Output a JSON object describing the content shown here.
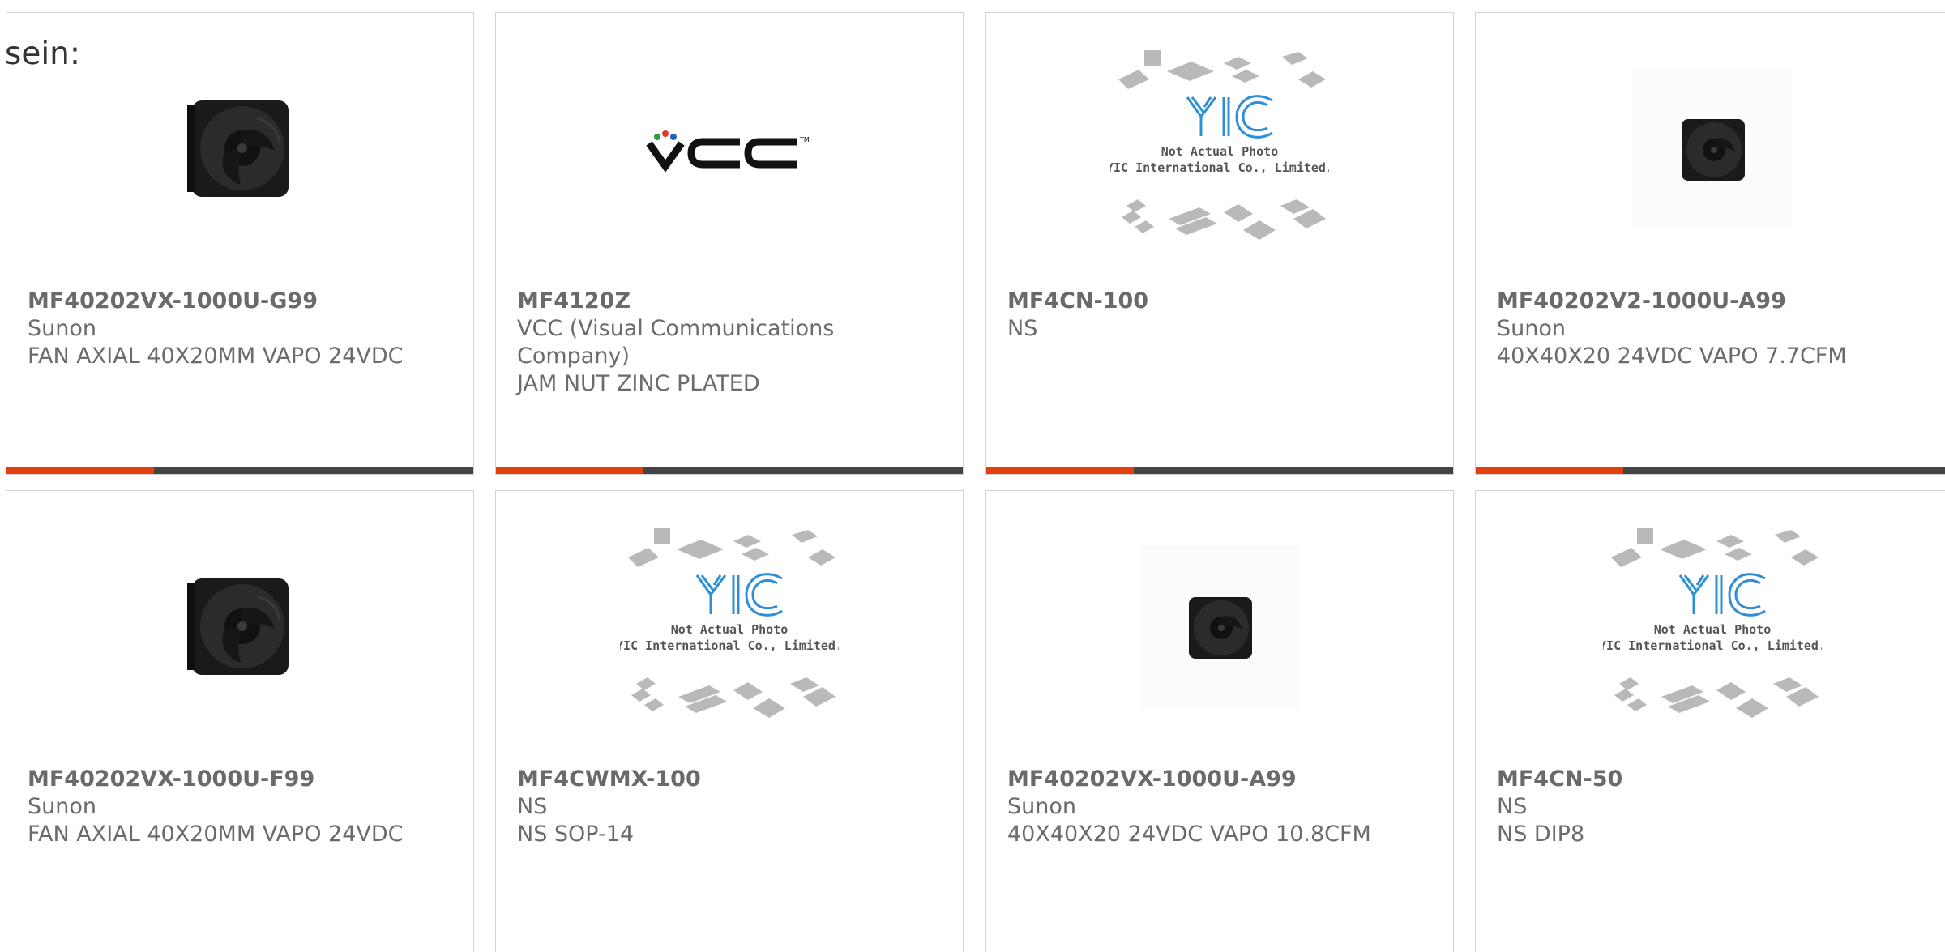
{
  "lead_text": "sein:",
  "colors": {
    "accent": "#e3400f",
    "bar": "#444444",
    "text": "#6b6b6b",
    "border": "#d3d3d3"
  },
  "products": [
    {
      "part": "MF40202VX-1000U-G99",
      "maker": "Sunon",
      "desc": "FAN AXIAL 40X20MM VAPO 24VDC",
      "image": "fan-image"
    },
    {
      "part": "MF4120Z",
      "maker": "VCC (Visual Communications Company)",
      "desc": "JAM NUT ZINC PLATED",
      "image": "vcc-logo-image"
    },
    {
      "part": "MF4CN-100",
      "maker": "NS",
      "desc": "",
      "image": "yic-placeholder-image"
    },
    {
      "part": "MF40202V2-1000U-A99",
      "maker": "Sunon",
      "desc": "40X40X20 24VDC VAPO 7.7CFM",
      "image": "fan-image-small"
    },
    {
      "part": "MF40202VX-1000U-F99",
      "maker": "Sunon",
      "desc": "FAN AXIAL 40X20MM VAPO 24VDC",
      "image": "fan-image"
    },
    {
      "part": "MF4CWMX-100",
      "maker": "NS",
      "desc": "NS SOP-14",
      "image": "yic-placeholder-image"
    },
    {
      "part": "MF40202VX-1000U-A99",
      "maker": "Sunon",
      "desc": "40X40X20 24VDC VAPO 10.8CFM",
      "image": "fan-image-small"
    },
    {
      "part": "MF4CN-50",
      "maker": "NS",
      "desc": "NS DIP8",
      "image": "yic-placeholder-image"
    }
  ],
  "yic": {
    "logo": "YIC",
    "line1": "Not Actual Photo",
    "line2": "YIC International Co., Limited."
  }
}
